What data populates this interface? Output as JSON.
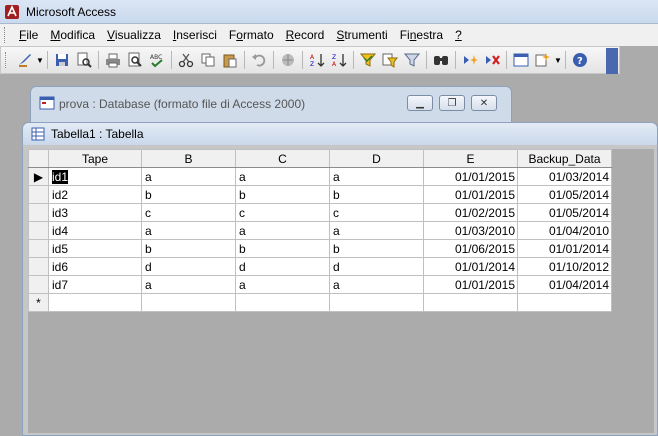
{
  "app": {
    "title": "Microsoft Access"
  },
  "menu": [
    {
      "label": "File",
      "u": "F"
    },
    {
      "label": "Modifica",
      "u": "M"
    },
    {
      "label": "Visualizza",
      "u": "V"
    },
    {
      "label": "Inserisci",
      "u": "I"
    },
    {
      "label": "Formato",
      "u": "o"
    },
    {
      "label": "Record",
      "u": "R"
    },
    {
      "label": "Strumenti",
      "u": "S"
    },
    {
      "label": "Finestra",
      "u": "n"
    },
    {
      "label": "?",
      "u": "?"
    }
  ],
  "db_window": {
    "title": "prova : Database (formato file di Access 2000)"
  },
  "table_window": {
    "title": "Tabella1 : Tabella"
  },
  "grid": {
    "columns": [
      "Tape",
      "B",
      "C",
      "D",
      "E",
      "Backup_Data"
    ],
    "rows": [
      [
        "id1",
        "a",
        "a",
        "a",
        "01/01/2015",
        "01/03/2014"
      ],
      [
        "id2",
        "b",
        "b",
        "b",
        "01/01/2015",
        "01/05/2014"
      ],
      [
        "id3",
        "c",
        "c",
        "c",
        "01/02/2015",
        "01/05/2014"
      ],
      [
        "id4",
        "a",
        "a",
        "a",
        "01/03/2010",
        "01/04/2010"
      ],
      [
        "id5",
        "b",
        "b",
        "b",
        "01/06/2015",
        "01/01/2014"
      ],
      [
        "id6",
        "d",
        "d",
        "d",
        "01/01/2014",
        "01/10/2012"
      ],
      [
        "id7",
        "a",
        "a",
        "a",
        "01/01/2015",
        "01/04/2014"
      ]
    ],
    "new_row_marker": "*",
    "current_row_marker": "▶"
  },
  "colors": {
    "accent": "#4a68b0",
    "mdi_bg": "#ababab"
  }
}
